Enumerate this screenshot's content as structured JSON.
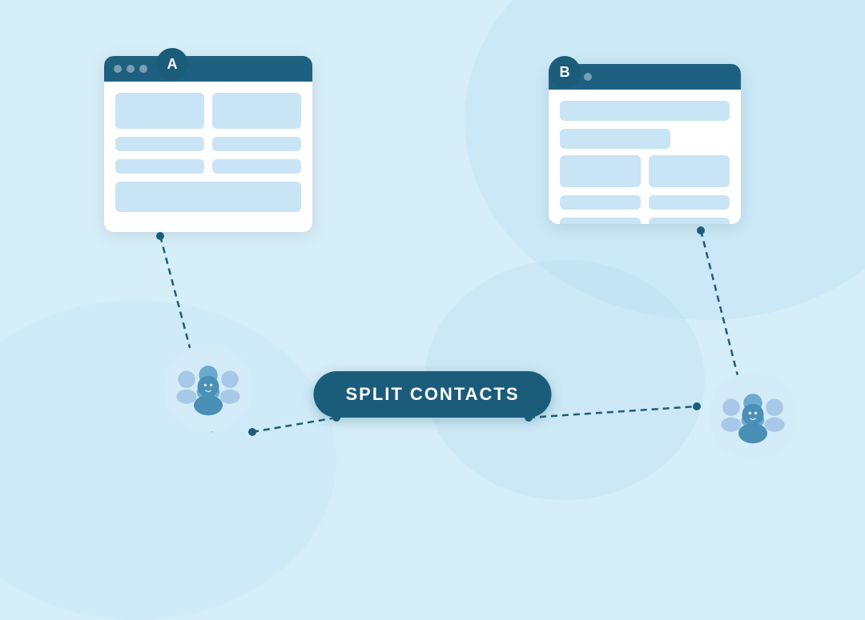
{
  "background": {
    "color": "#d6eef8"
  },
  "badge_a": {
    "label": "A"
  },
  "badge_b": {
    "label": "B"
  },
  "split_contacts": {
    "label": "SPLIT CONTACTS"
  },
  "windows": [
    {
      "id": "window-a",
      "badge": "A"
    },
    {
      "id": "window-b",
      "badge": "B"
    }
  ],
  "icons": {
    "group_left": "group-icon",
    "group_right": "group-icon"
  }
}
